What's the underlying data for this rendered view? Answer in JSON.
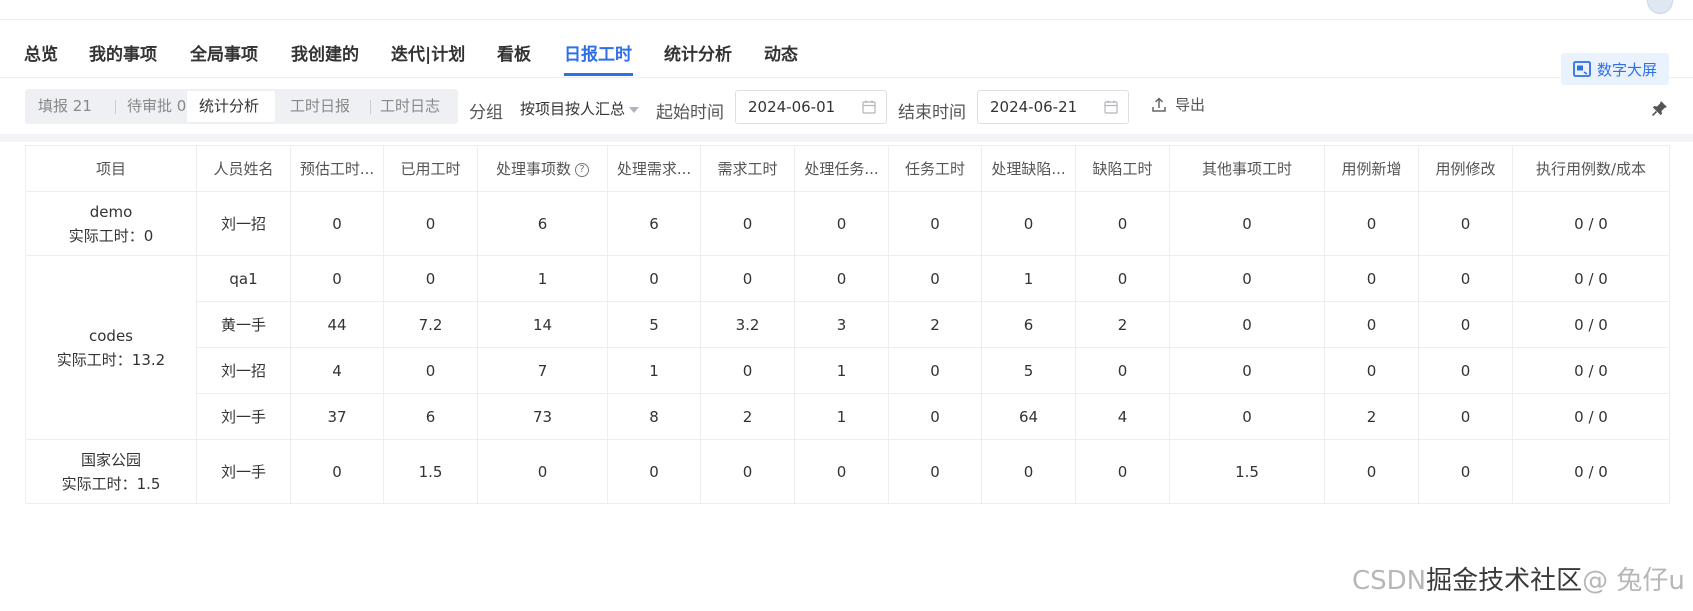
{
  "nav": {
    "items": [
      "总览",
      "我的事项",
      "全局事项",
      "我创建的",
      "迭代|计划",
      "看板",
      "日报工时",
      "统计分析",
      "动态"
    ],
    "active_index": 6,
    "screen_button": "数字大屏"
  },
  "toolbar": {
    "seg": {
      "fill_label": "填报",
      "fill_count": "21",
      "pending_label": "待审批",
      "pending_count": "0",
      "stats": "统计分析",
      "daily": "工时日报",
      "log": "工时日志"
    },
    "group_label": "分组",
    "group_value": "按项目按人汇总",
    "start_label": "起始时间",
    "start_value": "2024-06-01",
    "end_label": "结束时间",
    "end_value": "2024-06-21",
    "export_label": "导出"
  },
  "table": {
    "headers": [
      "项目",
      "人员姓名",
      "预估工时...",
      "已用工时",
      "处理事项数",
      "处理需求...",
      "需求工时",
      "处理任务...",
      "任务工时",
      "处理缺陷...",
      "缺陷工时",
      "其他事项工时",
      "用例新增",
      "用例修改",
      "执行用例数/成本"
    ],
    "groups": [
      {
        "name": "demo",
        "actual": "实际工时：0",
        "rows": [
          [
            "刘一招",
            "0",
            "0",
            "6",
            "6",
            "0",
            "0",
            "0",
            "0",
            "0",
            "0",
            "0",
            "0",
            "0 / 0"
          ]
        ]
      },
      {
        "name": "codes",
        "actual": "实际工时：13.2",
        "rows": [
          [
            "qa1",
            "0",
            "0",
            "1",
            "0",
            "0",
            "0",
            "0",
            "1",
            "0",
            "0",
            "0",
            "0",
            "0 / 0"
          ],
          [
            "黄一手",
            "44",
            "7.2",
            "14",
            "5",
            "3.2",
            "3",
            "2",
            "6",
            "2",
            "0",
            "0",
            "0",
            "0 / 0"
          ],
          [
            "刘一招",
            "4",
            "0",
            "7",
            "1",
            "0",
            "1",
            "0",
            "5",
            "0",
            "0",
            "0",
            "0",
            "0 / 0"
          ],
          [
            "刘一手",
            "37",
            "6",
            "73",
            "8",
            "2",
            "1",
            "0",
            "64",
            "4",
            "0",
            "2",
            "0",
            "0 / 0"
          ]
        ]
      },
      {
        "name": "国家公园",
        "actual": "实际工时：1.5",
        "rows": [
          [
            "刘一手",
            "0",
            "1.5",
            "0",
            "0",
            "0",
            "0",
            "0",
            "0",
            "0",
            "1.5",
            "0",
            "0",
            "0 / 0"
          ]
        ]
      }
    ]
  },
  "watermark": {
    "grey": "CSDN",
    "dark": "掘金技术社区",
    "tail": "@ 兔仔u"
  }
}
